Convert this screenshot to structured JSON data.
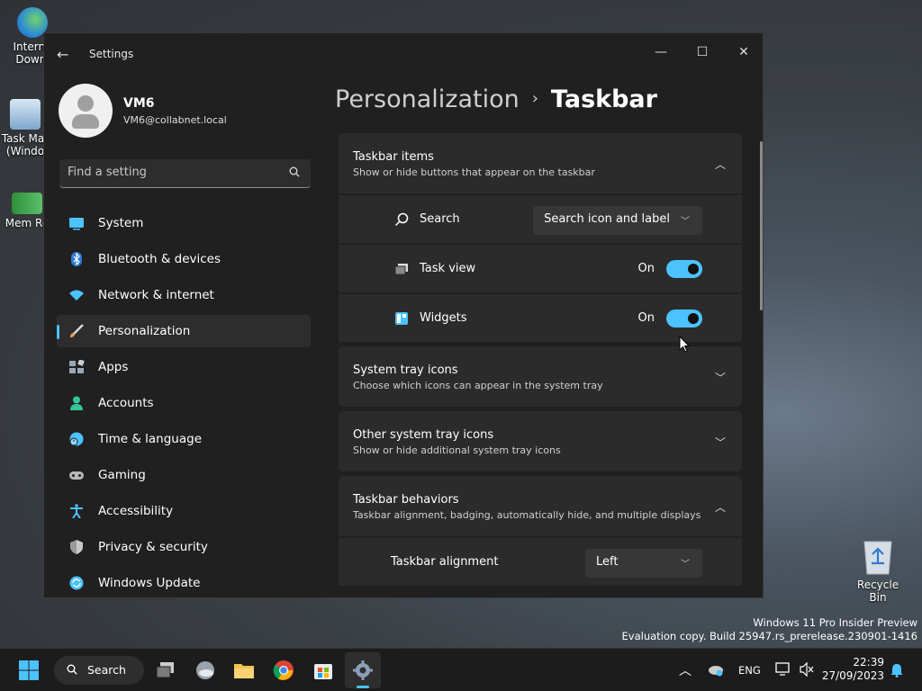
{
  "window": {
    "title": "Settings"
  },
  "profile": {
    "name": "VM6",
    "email": "VM6@collabnet.local"
  },
  "search": {
    "placeholder": "Find a setting"
  },
  "nav": [
    {
      "label": "System",
      "icon": "system-icon",
      "color": "#4cc2ff"
    },
    {
      "label": "Bluetooth & devices",
      "icon": "bluetooth-icon",
      "color": "#2e7bd6"
    },
    {
      "label": "Network & internet",
      "icon": "wifi-icon",
      "color": "#4cc2ff"
    },
    {
      "label": "Personalization",
      "icon": "brush-icon",
      "color": "#e8a25a",
      "active": true
    },
    {
      "label": "Apps",
      "icon": "apps-icon",
      "color": "#9aa7b5"
    },
    {
      "label": "Accounts",
      "icon": "accounts-icon",
      "color": "#35c59a"
    },
    {
      "label": "Time & language",
      "icon": "globe-clock-icon",
      "color": "#4cc2ff"
    },
    {
      "label": "Gaming",
      "icon": "gamepad-icon",
      "color": "#b8b8b8"
    },
    {
      "label": "Accessibility",
      "icon": "accessibility-icon",
      "color": "#4cc2ff"
    },
    {
      "label": "Privacy & security",
      "icon": "shield-icon",
      "color": "#9a9a9a"
    },
    {
      "label": "Windows Update",
      "icon": "update-icon",
      "color": "#4cc2ff"
    }
  ],
  "breadcrumb": {
    "parent": "Personalization",
    "separator": "›",
    "current": "Taskbar"
  },
  "sections": {
    "taskbar_items": {
      "title": "Taskbar items",
      "subtitle": "Show or hide buttons that appear on the taskbar",
      "search": {
        "label": "Search",
        "value": "Search icon and label"
      },
      "task_view": {
        "label": "Task view",
        "state": "On"
      },
      "widgets": {
        "label": "Widgets",
        "state": "On"
      }
    },
    "system_tray": {
      "title": "System tray icons",
      "subtitle": "Choose which icons can appear in the system tray"
    },
    "other_tray": {
      "title": "Other system tray icons",
      "subtitle": "Show or hide additional system tray icons"
    },
    "behaviors": {
      "title": "Taskbar behaviors",
      "subtitle": "Taskbar alignment, badging, automatically hide, and multiple displays",
      "alignment": {
        "label": "Taskbar alignment",
        "value": "Left"
      }
    }
  },
  "desktop": {
    "icons": [
      {
        "label": "Interne Downl",
        "icon": "idm-icon"
      },
      {
        "label": "Task Mar (Windo",
        "icon": "task-manager-icon"
      },
      {
        "label": "Mem Re",
        "icon": "memory-icon"
      }
    ],
    "recycle_bin": "Recycle Bin",
    "watermark_line1": "Windows 11 Pro Insider Preview",
    "watermark_line2": "Evaluation copy. Build 25947.rs_prerelease.230901-1416"
  },
  "taskbar": {
    "search_label": "Search",
    "language": "ENG",
    "time": "22:39",
    "date": "27/09/2023"
  },
  "colors": {
    "accent": "#4cc2ff",
    "window_bg": "#202020",
    "card_bg": "#2b2b2b"
  }
}
